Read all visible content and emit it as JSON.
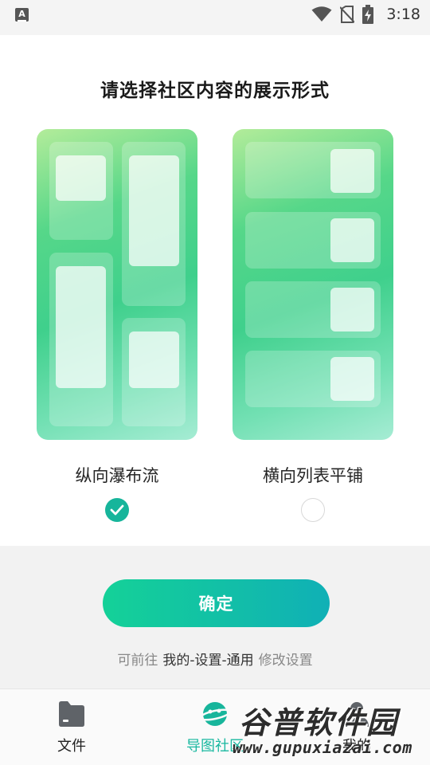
{
  "status_bar": {
    "app_badge": "A",
    "time": "3:18",
    "icons": [
      "wifi-icon",
      "no-sim-icon",
      "battery-charging-icon"
    ]
  },
  "page": {
    "title": "请选择社区内容的展示形式"
  },
  "options": [
    {
      "label": "纵向瀑布流",
      "selected": true
    },
    {
      "label": "横向列表平铺",
      "selected": false
    }
  ],
  "colors": {
    "accent": "#17b59b",
    "button_start": "#14d198",
    "button_end": "#10b0b6"
  },
  "confirm": {
    "label": "确定"
  },
  "hint": {
    "prefix": "可前往",
    "path": "我的-设置-通用",
    "suffix": "修改设置"
  },
  "bottom_nav": {
    "items": [
      {
        "label": "文件",
        "icon": "folder-icon",
        "active": false
      },
      {
        "label": "导图社区",
        "icon": "planet-icon",
        "active": true
      },
      {
        "label": "我的",
        "icon": "user-icon",
        "active": false
      }
    ]
  },
  "watermark": {
    "title": "谷普软件园",
    "url": "www.gupuxiazai.com"
  }
}
